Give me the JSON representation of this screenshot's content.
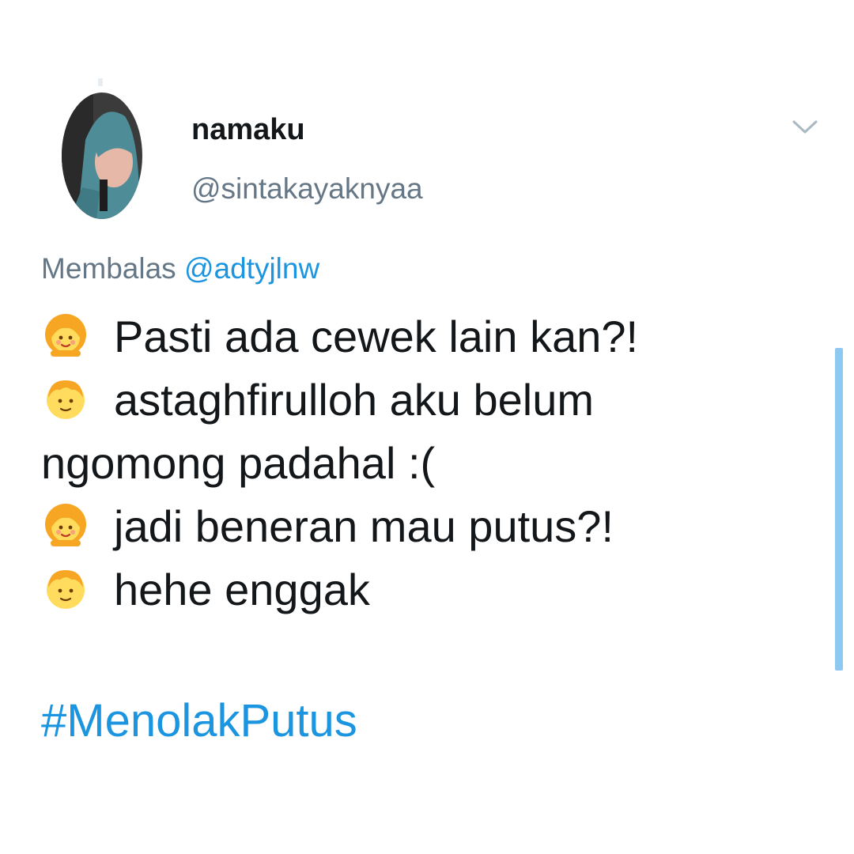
{
  "tweet": {
    "display_name": "namaku",
    "handle": "@sintakayaknyaa",
    "reply_prefix": "Membalas",
    "reply_mention": "@adtyjlnw",
    "lines": [
      {
        "emoji": "girl-emoji",
        "text": "Pasti ada cewek lain kan?!"
      },
      {
        "emoji": "boy-emoji",
        "text": "astaghfirulloh aku belum"
      },
      {
        "emoji": "",
        "text": "ngomong padahal :("
      },
      {
        "emoji": "girl-emoji",
        "text": "jadi beneran mau putus?!"
      },
      {
        "emoji": "boy-emoji",
        "text": "hehe enggak"
      }
    ],
    "hashtag": "#MenolakPutus"
  },
  "icons": {
    "menu": "chevron-down-icon",
    "girl": "girl-emoji-icon",
    "boy": "boy-emoji-icon"
  },
  "colors": {
    "text": "#14171a",
    "secondary": "#657786",
    "link": "#1b95e0",
    "scrollbar": "#8ec9f2"
  }
}
